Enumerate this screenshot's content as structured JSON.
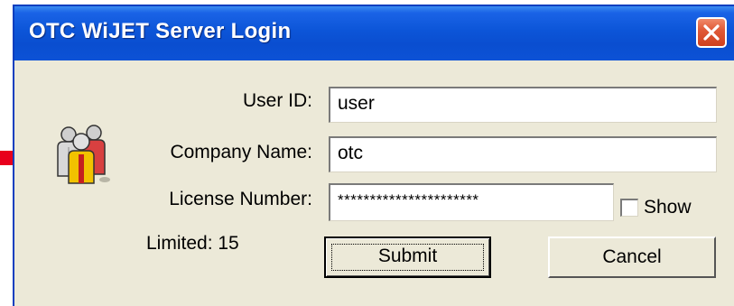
{
  "window": {
    "title": "OTC WiJET Server Login"
  },
  "form": {
    "user_id": {
      "label": "User ID:",
      "value": "user"
    },
    "company_name": {
      "label": "Company Name:",
      "value": "otc"
    },
    "license_number": {
      "label": "License Number:",
      "value": "**********************"
    },
    "show": {
      "label": "Show",
      "checked": false
    },
    "limited": "Limited:  15"
  },
  "buttons": {
    "submit": "Submit",
    "cancel": "Cancel"
  },
  "icons": {
    "close": "close-icon",
    "users": "users-group-icon",
    "arrow": "red-arrow-icon"
  },
  "colors": {
    "titlebar": "#0c55d8",
    "close_button": "#d0401e",
    "window_bg": "#ece9d8",
    "arrow": "#e8001c"
  }
}
